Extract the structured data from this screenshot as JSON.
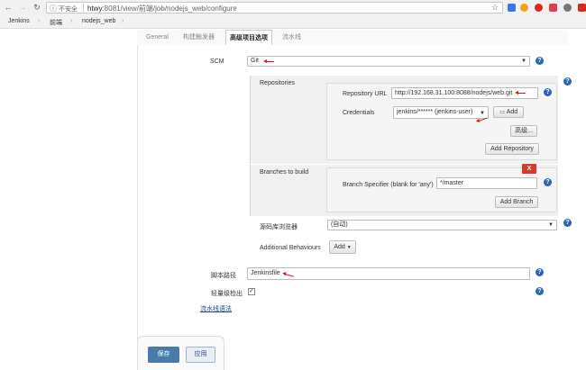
{
  "browser": {
    "security_label": "不安全",
    "url_host": "htwy",
    "url_rest": ":8081/view/前端/job/nodejs_web/configure",
    "extensions": [
      {
        "name": "translate-extension",
        "color": "#3b78e7"
      },
      {
        "name": "extension-orange",
        "color": "#f4a11b"
      },
      {
        "name": "opera-extension",
        "color": "#e0261f"
      },
      {
        "name": "pocket-extension",
        "color": "#e33b4e"
      },
      {
        "name": "extension-gear",
        "color": "#777777"
      },
      {
        "name": "extension-red",
        "color": "#d42a1f"
      }
    ]
  },
  "breadcrumb": [
    "Jenkins",
    "前端",
    "nodejs_web"
  ],
  "tabs": [
    "General",
    "构建触发器",
    "高级项目选项",
    "流水线"
  ],
  "form": {
    "scm_label": "SCM",
    "scm_value": "Git",
    "repositories_label": "Repositories",
    "repo_url_label": "Repository URL",
    "repo_url_value": "http://192.168.31.100:8088/nodejs/web.git",
    "credentials_label": "Credentials",
    "credentials_value": "jenkins/****** (jenkins-user)",
    "add_button": "Add",
    "advanced_button": "高级...",
    "add_repository_button": "Add Repository",
    "branches_label": "Branches to build",
    "delete_button": "X",
    "branch_specifier_label": "Branch Specifier (blank for 'any')",
    "branch_specifier_value": "*/master",
    "add_branch_button": "Add Branch",
    "browser_label": "源码库浏览器",
    "browser_value": "(自动)",
    "behaviours_label": "Additional Behaviours",
    "behaviours_add": "Add",
    "script_path_label": "脚本路径",
    "script_path_value": "Jenkinsfile",
    "lightweight_label": "轻量级检出",
    "lightweight_checked": true,
    "pipeline_syntax_link": "流水线语法",
    "help_icon_glyph": "?"
  },
  "bottom": {
    "save": "保存",
    "apply": "应用"
  },
  "colors": {
    "accent": "#4a7aa7",
    "help": "#2a64b3",
    "annotation": "#dd1111",
    "delete": "#d43b2b"
  }
}
